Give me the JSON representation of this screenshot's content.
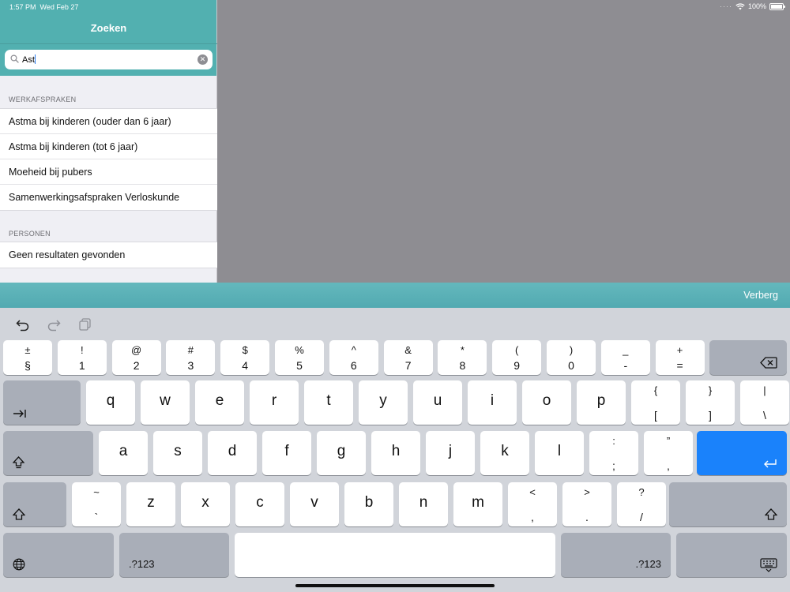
{
  "status": {
    "time": "1:57 PM",
    "date": "Wed Feb 27",
    "battery": "100%"
  },
  "panel": {
    "title": "Zoeken",
    "search": {
      "value": "Ast"
    },
    "section_1": {
      "title": "WERKAFSPRAKEN",
      "items": [
        "Astma bij kinderen (ouder dan 6 jaar)",
        "Astma bij kinderen (tot 6 jaar)",
        "Moeheid bij pubers",
        "Samenwerkingsafspraken Verloskunde"
      ]
    },
    "section_2": {
      "title": "PERSONEN",
      "items": [
        "Geen resultaten gevonden"
      ]
    }
  },
  "toolbar": {
    "hide_label": "Verberg"
  },
  "keyboard": {
    "number_row": [
      {
        "top": "±",
        "bot": "§"
      },
      {
        "top": "!",
        "bot": "1"
      },
      {
        "top": "@",
        "bot": "2"
      },
      {
        "top": "#",
        "bot": "3"
      },
      {
        "top": "$",
        "bot": "4"
      },
      {
        "top": "%",
        "bot": "5"
      },
      {
        "top": "^",
        "bot": "6"
      },
      {
        "top": "&",
        "bot": "7"
      },
      {
        "top": "*",
        "bot": "8"
      },
      {
        "top": "(",
        "bot": "9"
      },
      {
        "top": ")",
        "bot": "0"
      },
      {
        "top": "_",
        "bot": "-"
      },
      {
        "top": "+",
        "bot": "="
      }
    ],
    "row_q": [
      "q",
      "w",
      "e",
      "r",
      "t",
      "y",
      "u",
      "i",
      "o",
      "p"
    ],
    "row_q_sym": [
      {
        "top": "{",
        "bot": "["
      },
      {
        "top": "}",
        "bot": "]"
      },
      {
        "top": "|",
        "bot": "\\"
      }
    ],
    "row_a": [
      "a",
      "s",
      "d",
      "f",
      "g",
      "h",
      "j",
      "k",
      "l"
    ],
    "row_a_sym": [
      {
        "top": ":",
        "bot": ";"
      },
      {
        "top": "”",
        "bot": ","
      }
    ],
    "row_z_first": {
      "top": "~",
      "bot": "`"
    },
    "row_z": [
      "z",
      "x",
      "c",
      "v",
      "b",
      "n",
      "m"
    ],
    "row_z_sym": [
      {
        "top": "<",
        "bot": ","
      },
      {
        "top": ">",
        "bot": "."
      },
      {
        "top": "?",
        "bot": "/"
      }
    ],
    "numbers_label": ".?123",
    "colors": {
      "return_key": "#1a82fb",
      "header": "#52b0b0"
    }
  }
}
